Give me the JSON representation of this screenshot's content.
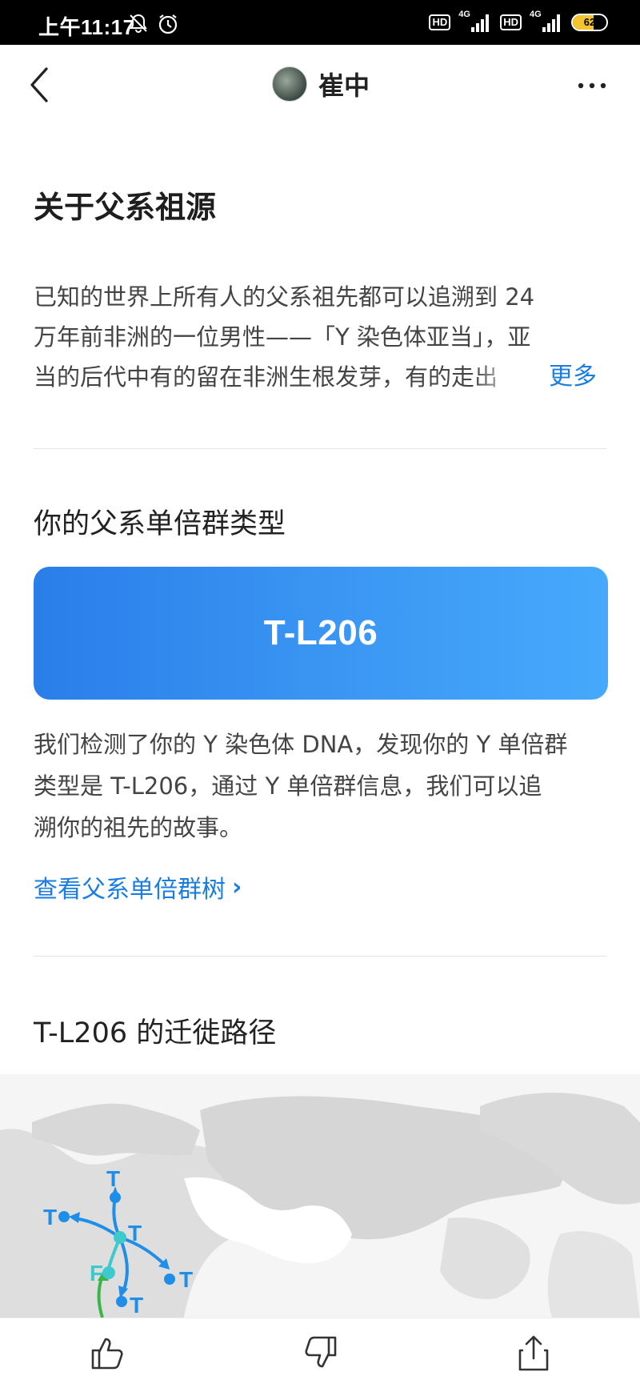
{
  "status_bar": {
    "time": "上午11:17",
    "network1": "4G",
    "network2": "4G",
    "hd1": "HD",
    "hd2": "HD",
    "battery": "62"
  },
  "nav": {
    "title": "崔中"
  },
  "about": {
    "title": "关于父系祖源",
    "lines": [
      "已知的世界上所有人的父系祖先都可以追溯到 24",
      "万年前非洲的一位男性——「Y 染色体亚当」，亚",
      "当的后代中有的留在非洲生根发芽，有的走出"
    ],
    "more": "更多"
  },
  "haplogroup": {
    "title": "你的父系单倍群类型",
    "type": "T-L206",
    "desc_lines": [
      "我们检测了你的 Y 染色体 DNA，发现你的 Y 单倍群",
      "类型是 T-L206，通过 Y 单倍群信息，我们可以追",
      "溯你的祖先的故事。"
    ],
    "tree_link": "查看父系单倍群树"
  },
  "migration": {
    "title": "T-L206 的迁徙路径",
    "labels": {
      "n": "T",
      "w": "T",
      "c": "T",
      "e": "T",
      "s": "T",
      "f": "F"
    },
    "colors": {
      "route": "#1e8ee9",
      "origin": "#3ec9cc",
      "prior": "#3bb54a"
    }
  },
  "colors": {
    "accent": "#1a7de0",
    "card_start": "#2a7ee9",
    "card_end": "#46a9fb"
  },
  "bottom_bar": {
    "icons": [
      "thumbs-up-icon",
      "thumbs-down-icon",
      "share-icon"
    ]
  }
}
